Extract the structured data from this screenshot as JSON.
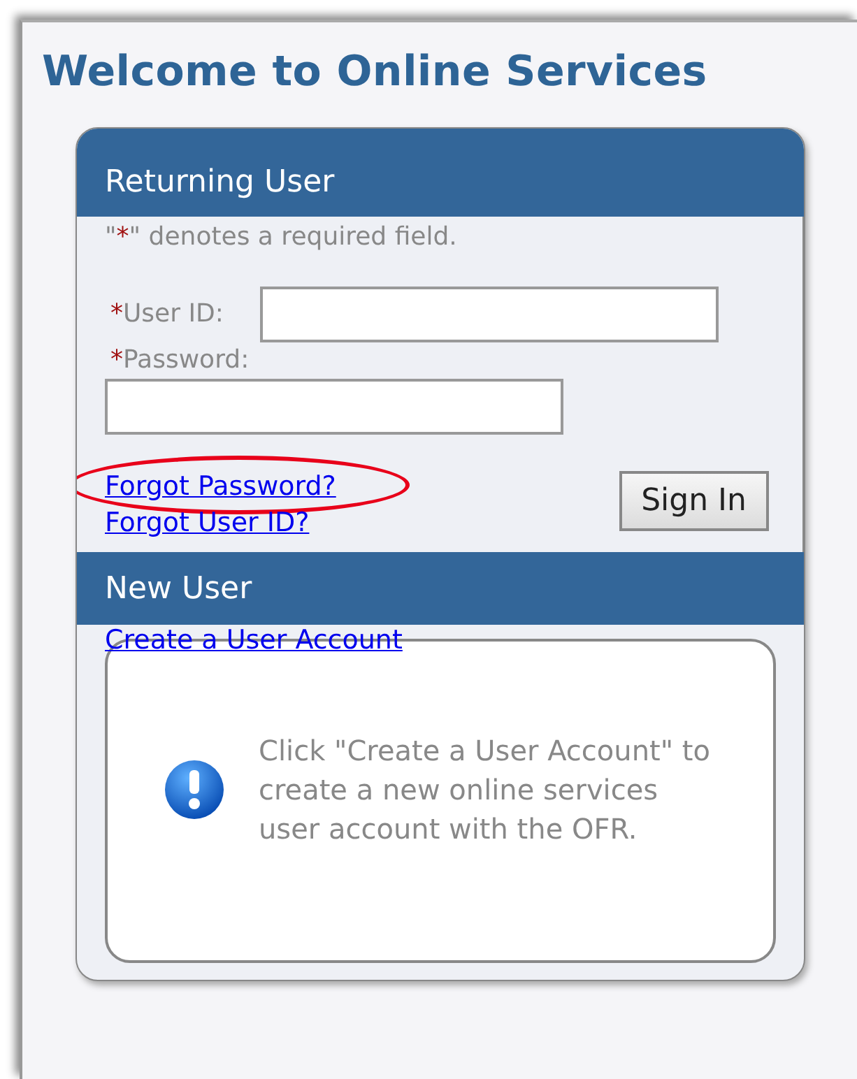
{
  "title": "Welcome to Online Services",
  "returning_user": {
    "heading": "Returning User",
    "required_note": {
      "open_quote": "\"",
      "mark": "*",
      "rest": "\" denotes a required field."
    },
    "fields": [
      {
        "kind": "inline",
        "mark": "*",
        "label": "User ID:"
      },
      {
        "kind": "stacked",
        "mark": "*",
        "label": "Password:"
      }
    ],
    "links": [
      {
        "text": "Forgot Password?",
        "highlighted": true
      },
      {
        "text": "Forgot User ID?",
        "highlighted": false
      }
    ],
    "button": "Sign In"
  },
  "new_user": {
    "heading": "New User",
    "link": "Create a User Account",
    "message": "Click \"Create a User Account\" to create a new online services user account with the OFR."
  }
}
